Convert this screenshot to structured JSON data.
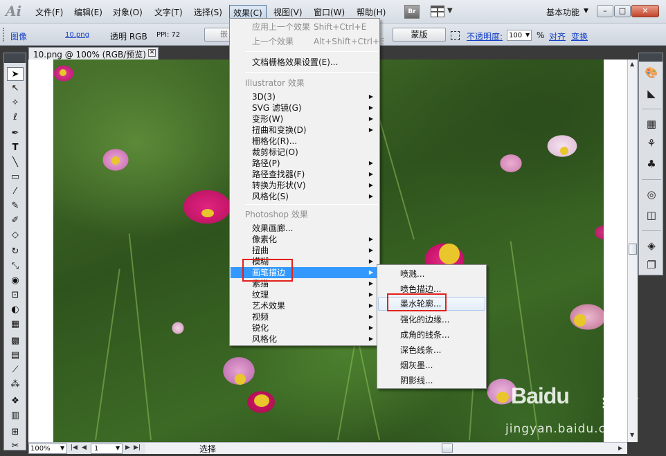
{
  "app": {
    "logo": "Ai"
  },
  "menubar": {
    "items": [
      "文件(F)",
      "编辑(E)",
      "对象(O)",
      "文字(T)",
      "选择(S)",
      "效果(C)",
      "视图(V)",
      "窗口(W)",
      "帮助(H)"
    ],
    "bridge_label": "Br",
    "workspace": "基本功能",
    "window_controls": [
      "–",
      "□",
      "✕"
    ]
  },
  "controlbar": {
    "image_link": "图像",
    "filename": "10.png",
    "transparency": "透明 RGB",
    "ppi": "PPI: 72",
    "embed_label": "嵌入",
    "mask_label": "蒙版",
    "opacity_label": "不透明度:",
    "opacity_value": "100",
    "percent": "%",
    "align_link": "对齐",
    "transform_link": "变换"
  },
  "document": {
    "tab_title": "10.png @ 100% (RGB/预览)",
    "close_glyph": "✕"
  },
  "statusbar": {
    "zoom": "100%",
    "page": "1",
    "label": "选择"
  },
  "effect_menu": {
    "apply_last": {
      "label": "应用上一个效果",
      "shortcut": "Shift+Ctrl+E"
    },
    "last_effect": {
      "label": "上一个效果",
      "shortcut": "Alt+Shift+Ctrl+E"
    },
    "doc_raster": "文档栅格效果设置(E)...",
    "illustrator_section": "Illustrator 效果",
    "illustrator_items": [
      "3D(3)",
      "SVG 滤镜(G)",
      "变形(W)",
      "扭曲和变换(D)",
      "栅格化(R)...",
      "裁剪标记(O)",
      "路径(P)",
      "路径查找器(F)",
      "转换为形状(V)",
      "风格化(S)"
    ],
    "photoshop_section": "Photoshop 效果",
    "photoshop_items": [
      "效果画廊...",
      "像素化",
      "扭曲",
      "模糊",
      "画笔描边",
      "素描",
      "纹理",
      "艺术效果",
      "视频",
      "锐化",
      "风格化"
    ]
  },
  "brush_submenu": {
    "items": [
      "喷溅...",
      "喷色描边...",
      "墨水轮廓...",
      "强化的边缘...",
      "成角的线条...",
      "深色线条...",
      "烟灰墨...",
      "阴影线..."
    ]
  },
  "watermark": {
    "brand": "Baidu",
    "cn": "经验",
    "url": "jingyan.baidu.com"
  },
  "colors": {
    "menu_highlight": "#3399ff",
    "annotation_red": "#e3201b",
    "link_blue": "#1540c8"
  }
}
